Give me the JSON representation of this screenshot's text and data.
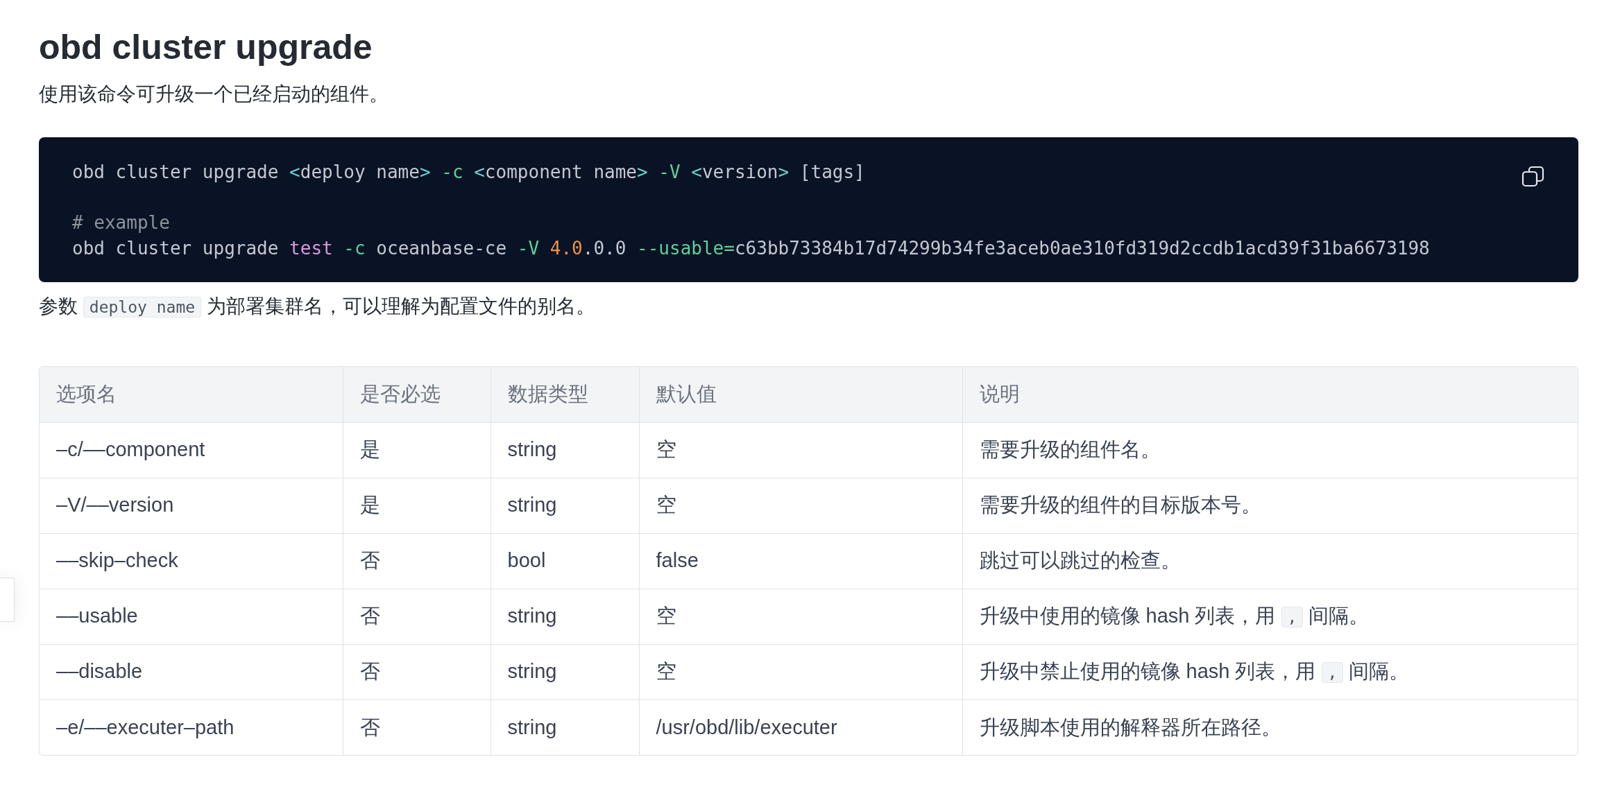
{
  "title": "obd cluster upgrade",
  "intro": "使用该命令可升级一个已经启动的组件。",
  "code_block": {
    "lines": [
      {
        "blank_before": false,
        "tokens": [
          {
            "kind": "plain",
            "text": "obd cluster upgrade "
          },
          {
            "kind": "bracket",
            "text": "<"
          },
          {
            "kind": "plain",
            "text": "deploy name"
          },
          {
            "kind": "bracket",
            "text": ">"
          },
          {
            "kind": "flag",
            "text": " -c"
          },
          {
            "kind": "bracket",
            "text": " <"
          },
          {
            "kind": "plain",
            "text": "component name"
          },
          {
            "kind": "bracket",
            "text": ">"
          },
          {
            "kind": "flag",
            "text": " -V"
          },
          {
            "kind": "bracket",
            "text": " <"
          },
          {
            "kind": "plain",
            "text": "version"
          },
          {
            "kind": "bracket",
            "text": ">"
          },
          {
            "kind": "plain",
            "text": " [tags]"
          }
        ]
      },
      {
        "blank_before": true,
        "tokens": [
          {
            "kind": "comment",
            "text": "# example"
          }
        ]
      },
      {
        "blank_before": false,
        "tokens": [
          {
            "kind": "plain",
            "text": "obd cluster upgrade "
          },
          {
            "kind": "string",
            "text": "test"
          },
          {
            "kind": "flag",
            "text": " -c"
          },
          {
            "kind": "plain",
            "text": " oceanbase-ce "
          },
          {
            "kind": "flag",
            "text": "-V"
          },
          {
            "kind": "number",
            "text": " 4.0"
          },
          {
            "kind": "plain",
            "text": ".0.0 "
          },
          {
            "kind": "flag",
            "text": "--usable="
          },
          {
            "kind": "plain",
            "text": "c63bb73384b17d74299b34fe3aceb0ae310fd319d2ccdb1acd39f31ba6673198"
          }
        ]
      }
    ]
  },
  "note": [
    {
      "kind": "text",
      "text": "参数 "
    },
    {
      "kind": "code",
      "text": "deploy name"
    },
    {
      "kind": "text",
      "text": " 为部署集群名，可以理解为配置文件的别名。"
    }
  ],
  "table": {
    "columns": [
      "选项名",
      "是否必选",
      "数据类型",
      "默认值",
      "说明"
    ],
    "rows": [
      [
        "–c/––component",
        "是",
        "string",
        "空",
        "需要升级的组件名。"
      ],
      [
        "–V/––version",
        "是",
        "string",
        "空",
        "需要升级的组件的目标版本号。"
      ],
      [
        "––skip–check",
        "否",
        "bool",
        "false",
        "跳过可以跳过的检查。"
      ],
      [
        "––usable",
        "否",
        "string",
        "空",
        [
          {
            "kind": "text",
            "text": "升级中使用的镜像 hash 列表，用 "
          },
          {
            "kind": "code",
            "text": ","
          },
          {
            "kind": "text",
            "text": " 间隔。"
          }
        ]
      ],
      [
        "––disable",
        "否",
        "string",
        "空",
        [
          {
            "kind": "text",
            "text": "升级中禁止使用的镜像 hash 列表，用 "
          },
          {
            "kind": "code",
            "text": ","
          },
          {
            "kind": "text",
            "text": " 间隔。"
          }
        ]
      ],
      [
        "–e/––executer–path",
        "否",
        "string",
        "/usr/obd/lib/executer",
        "升级脚本使用的解释器所在路径。"
      ]
    ]
  }
}
